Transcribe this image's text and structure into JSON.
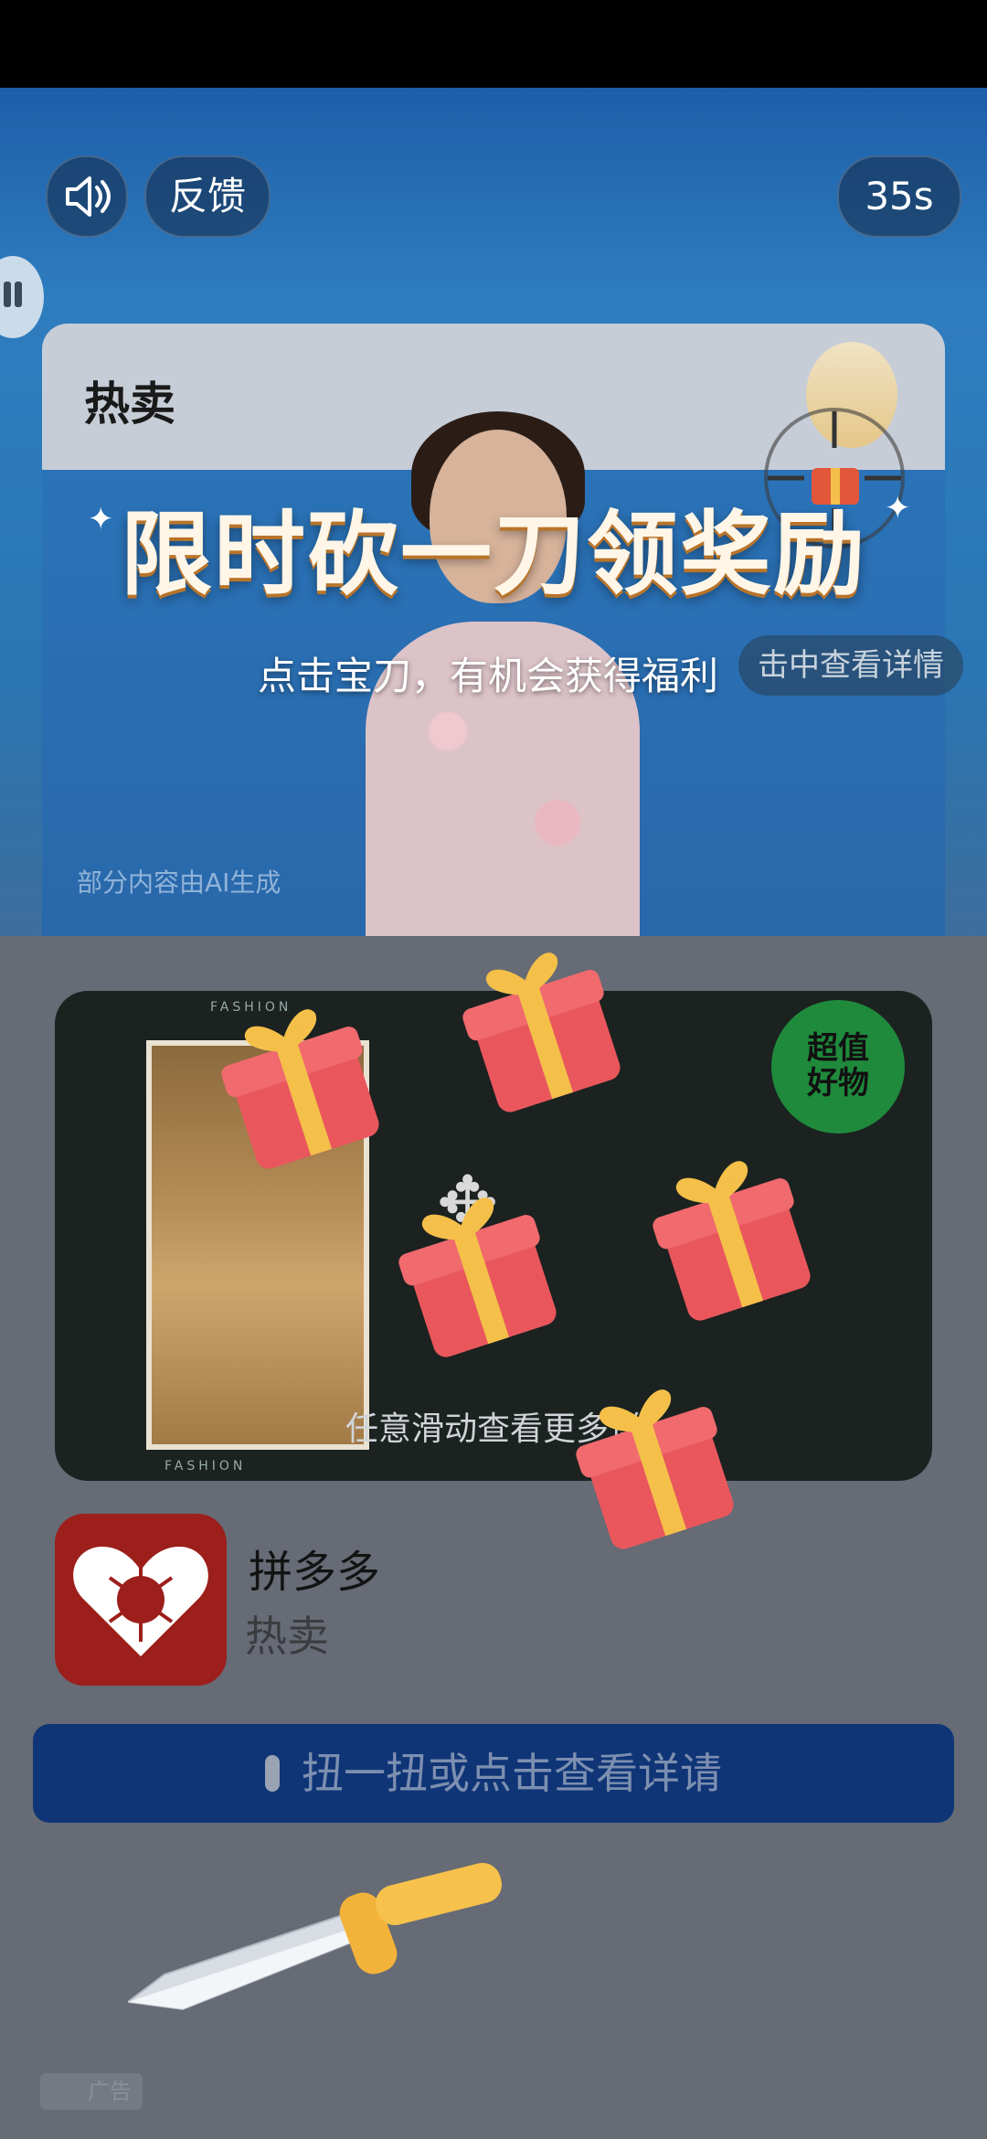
{
  "controls": {
    "feedback_label": "反馈",
    "timer_label": "35s"
  },
  "card": {
    "title": "热卖",
    "headline": "限时砍一刀领奖励",
    "subline": "点击宝刀，有机会获得福利",
    "detail_pill": "击中查看详情",
    "ai_note": "部分内容由AI生成"
  },
  "product": {
    "swipe_hint": "任意滑动查看更多详",
    "badge_text": "超值好物",
    "stripe_text": "FASHION"
  },
  "app": {
    "name": "拼多多",
    "tag": "热卖"
  },
  "cta": {
    "label": "扭一扭或点击查看详请"
  },
  "ad": {
    "label": "广告"
  },
  "colors": {
    "cta_bg": "#0f3577",
    "app_icon_bg": "#9c1f1b",
    "gift_red": "#e9575c",
    "gift_ribbon": "#f4c04a"
  },
  "icons": {
    "sound": "speaker-icon",
    "gift": "gift-icon",
    "sword": "sword-icon",
    "mic": "phone-shake-icon"
  }
}
